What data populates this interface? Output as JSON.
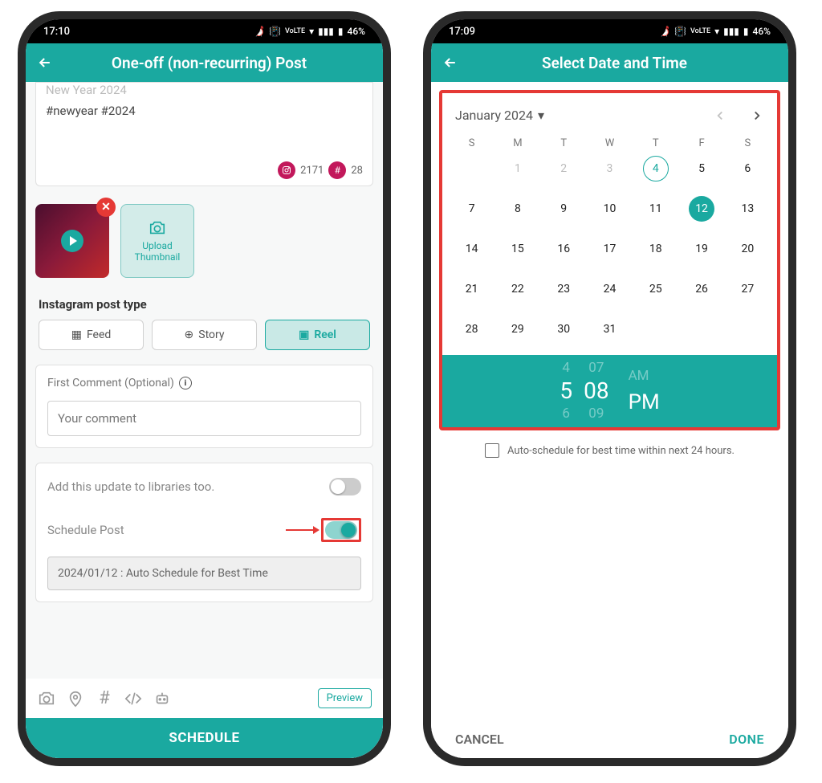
{
  "left": {
    "status": {
      "time": "17:10",
      "battery": "46%"
    },
    "header": {
      "title": "One-off (non-recurring) Post"
    },
    "post": {
      "line1": "New Year 2024",
      "hashtags": "#newyear #2024",
      "char_count": "2171",
      "hash_count": "28"
    },
    "upload_thumb_label": "Upload Thumbnail",
    "section_post_type": "Instagram post type",
    "pills": {
      "feed": "Feed",
      "story": "Story",
      "reel": "Reel"
    },
    "first_comment": {
      "label": "First Comment (Optional)",
      "placeholder": "Your comment"
    },
    "toggles": {
      "libraries": "Add this update to libraries too.",
      "schedule": "Schedule Post"
    },
    "schedule_value": "2024/01/12 : Auto Schedule for Best Time",
    "preview_label": "Preview",
    "schedule_button": "SCHEDULE"
  },
  "right": {
    "status": {
      "time": "17:09",
      "battery": "46%"
    },
    "header": {
      "title": "Select Date and Time"
    },
    "calendar": {
      "month": "January 2024",
      "dow": [
        "S",
        "M",
        "T",
        "W",
        "T",
        "F",
        "S"
      ],
      "days": [
        {
          "n": "",
          "dim": true
        },
        {
          "n": "1",
          "dim": true
        },
        {
          "n": "2",
          "dim": true
        },
        {
          "n": "3",
          "dim": true
        },
        {
          "n": "4",
          "today": true
        },
        {
          "n": "5"
        },
        {
          "n": "6"
        },
        {
          "n": "7"
        },
        {
          "n": "8"
        },
        {
          "n": "9"
        },
        {
          "n": "10"
        },
        {
          "n": "11"
        },
        {
          "n": "12",
          "sel": true
        },
        {
          "n": "13"
        },
        {
          "n": "14"
        },
        {
          "n": "15"
        },
        {
          "n": "16"
        },
        {
          "n": "17"
        },
        {
          "n": "18"
        },
        {
          "n": "19"
        },
        {
          "n": "20"
        },
        {
          "n": "21"
        },
        {
          "n": "22"
        },
        {
          "n": "23"
        },
        {
          "n": "24"
        },
        {
          "n": "25"
        },
        {
          "n": "26"
        },
        {
          "n": "27"
        },
        {
          "n": "28"
        },
        {
          "n": "29"
        },
        {
          "n": "30"
        },
        {
          "n": "31"
        },
        {
          "n": ""
        },
        {
          "n": ""
        },
        {
          "n": ""
        }
      ]
    },
    "time": {
      "hour_prev": "4",
      "hour": "5",
      "hour_next": "6",
      "min_prev": "07",
      "min": "08",
      "min_next": "09",
      "ampm_prev": "AM",
      "ampm": "PM"
    },
    "autoschedule": "Auto-schedule for best time within next 24 hours.",
    "actions": {
      "cancel": "CANCEL",
      "done": "DONE"
    }
  }
}
